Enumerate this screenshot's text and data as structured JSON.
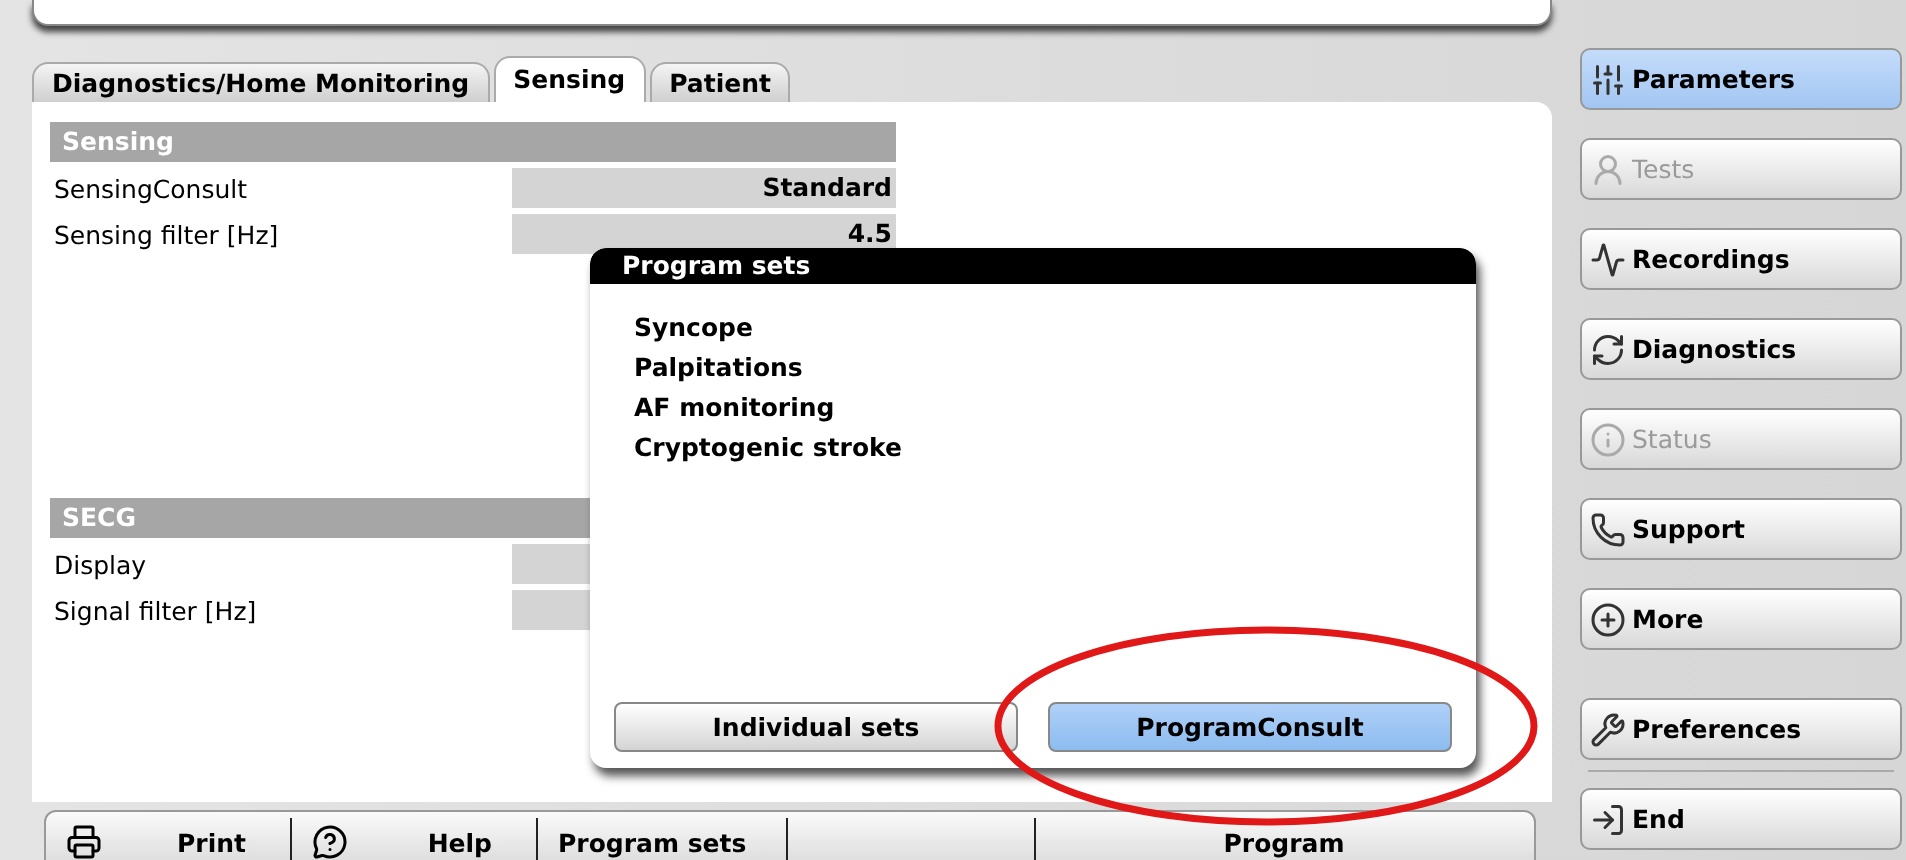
{
  "tabs": [
    {
      "label": "Diagnostics/Home Monitoring",
      "selected": false
    },
    {
      "label": "Sensing",
      "selected": true
    },
    {
      "label": "Patient",
      "selected": false
    }
  ],
  "sections": [
    {
      "title": "Sensing",
      "rows": [
        {
          "label": "SensingConsult",
          "value": "Standard"
        },
        {
          "label": "Sensing filter [Hz]",
          "value": "4.5"
        }
      ]
    },
    {
      "title": "SECG",
      "rows": [
        {
          "label": "Display"
        },
        {
          "label": "Signal filter [Hz]"
        }
      ]
    }
  ],
  "dialog": {
    "title": "Program sets",
    "items": [
      "Syncope",
      "Palpitations",
      "AF monitoring",
      "Cryptogenic stroke"
    ],
    "buttons": [
      {
        "label": "Individual sets",
        "selected": false,
        "highlighted": false
      },
      {
        "label": "ProgramConsult",
        "selected": true,
        "highlighted": true
      }
    ]
  },
  "bottom_bar": [
    {
      "kind": "print",
      "label": "Print"
    },
    {
      "kind": "help",
      "label": "Help"
    },
    {
      "kind": "text",
      "label": "Program sets"
    },
    {
      "kind": "empty"
    },
    {
      "kind": "text",
      "label": "Program"
    }
  ],
  "sidebar": [
    {
      "kind": "main",
      "items": [
        {
          "kind": "parameters",
          "label": "Parameters",
          "selected": true,
          "disabled": false
        },
        {
          "kind": "tests",
          "label": "Tests",
          "selected": false,
          "disabled": true
        },
        {
          "kind": "recordings",
          "label": "Recordings",
          "selected": false,
          "disabled": false
        },
        {
          "kind": "diagnostics",
          "label": "Diagnostics",
          "selected": false,
          "disabled": false
        },
        {
          "kind": "status",
          "label": "Status",
          "selected": false,
          "disabled": true
        },
        {
          "kind": "support",
          "label": "Support",
          "selected": false,
          "disabled": false
        },
        {
          "kind": "more",
          "label": "More",
          "selected": false,
          "disabled": false
        }
      ]
    },
    {
      "kind": "footer",
      "items": [
        {
          "kind": "preferences",
          "label": "Preferences",
          "selected": false,
          "disabled": false
        },
        {
          "kind": "end",
          "label": "End",
          "selected": false,
          "disabled": false
        }
      ]
    }
  ]
}
